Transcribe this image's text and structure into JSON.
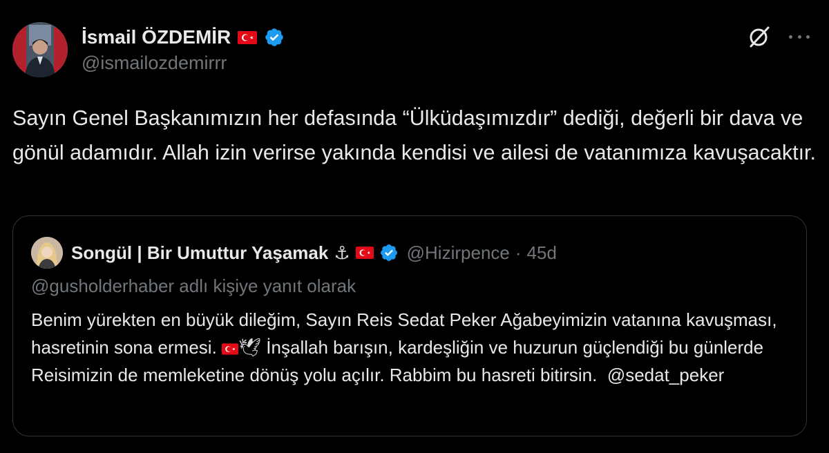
{
  "author": {
    "display_name": "İsmail ÖZDEMİR",
    "handle": "@ismailozdemirrr",
    "flag_icon": "turkey-flag-icon",
    "verified_icon": "verified-badge-icon"
  },
  "tweet": {
    "text": "Sayın Genel Başkanımızın her defasında “Ülküdaşımızdır” dediği, değerli bir dava ve gönül adamıdır. Allah izin verirse yakında kendisi ve ailesi de vatanımıza kavuşacaktır."
  },
  "toolbar": {
    "grok_icon": "grok-icon",
    "more_icon": "more-icon"
  },
  "quoted_tweet": {
    "display_name": "Songül | Bir Umuttur Yaşamak",
    "name_emoji": "⚓",
    "handle": "@Hizirpence",
    "separator": "·",
    "time": "45d",
    "reply_context": "@gusholderhaber adlı kişiye yanıt olarak",
    "text_part1": "Benim yürekten en büyük dileğim, Sayın Reis Sedat Peker Ağabeyimizin vatanına kavuşması, hasretinin sona ermesi.",
    "dove_emoji": "🕊",
    "text_part2": "İnşallah barışın, kardeşliğin ve huzurun güçlendiği bu günlerde Reisimizin de memleketine dönüş yolu açılır. Rabbim bu hasreti bitirsin.",
    "mention": "@sedat_peker"
  },
  "colors": {
    "background": "#000000",
    "text": "#e7e9ea",
    "muted": "#71767b",
    "border": "#2f3336",
    "verified": "#1d9bf0",
    "flag_red": "#e30a17"
  }
}
